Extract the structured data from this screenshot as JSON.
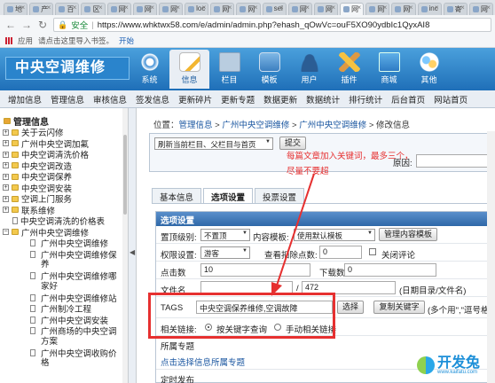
{
  "browser": {
    "tabs": [
      "地",
      "产",
      "百",
      "区",
      "网",
      "网",
      "网",
      "loc",
      "网",
      "网",
      "sei",
      "网",
      "网",
      "网",
      "网",
      "网",
      "inc",
      "寄",
      "网"
    ],
    "address": {
      "secure_label": "安全",
      "url": "https://www.whktwx58.com/e/admin/admin.php?ehash_qOwVc=ouF5XO90ydbIc1QyxAI8"
    },
    "bookmarks": {
      "apps_label": "应用",
      "hint": "请点击这里导入书签。",
      "import_label": "开始"
    }
  },
  "header": {
    "logo": "中央空调维修",
    "nav": [
      {
        "label": "系统",
        "icon": "system-gear-icon"
      },
      {
        "label": "信息",
        "icon": "info-document-icon"
      },
      {
        "label": "栏目",
        "icon": "column-folder-icon"
      },
      {
        "label": "模板",
        "icon": "template-window-icon"
      },
      {
        "label": "用户",
        "icon": "user-icon"
      },
      {
        "label": "插件",
        "icon": "plugin-tools-icon"
      },
      {
        "label": "商城",
        "icon": "shop-icon"
      },
      {
        "label": "其他",
        "icon": "other-icon"
      }
    ]
  },
  "menubar": [
    "增加信息",
    "管理信息",
    "审核信息",
    "签发信息",
    "更新碎片",
    "更新专题",
    "数据更新",
    "数据统计",
    "排行统计",
    "后台首页",
    "网站首页"
  ],
  "tree": {
    "title": "管理信息",
    "top_nodes": [
      "关于云闪修",
      "广州中央空调加氟",
      "中央空调清洗价格",
      "中央空调改造",
      "中央空调保养",
      "中央空调安装",
      "空调上门服务",
      "联系维修"
    ],
    "leaf_price": "中央空调清洗的价格表",
    "open_node": "广州中央空调维修",
    "children": [
      {
        "text": "广州中央空调维修"
      },
      {
        "text": "广州中央空调维修保",
        "cont": "养"
      },
      {
        "text": "广州中央空调维修哪",
        "cont": "家好"
      },
      {
        "text": "广州中央空调维修站"
      },
      {
        "text": "广州制冷工程"
      },
      {
        "text": "广州中央空调安装"
      },
      {
        "text": "广州商场的中央空调",
        "cont": "方案"
      },
      {
        "text": "广州中央空调收购价",
        "cont": "格"
      }
    ]
  },
  "main": {
    "breadcrumb": {
      "prefix": "位置：",
      "items": [
        "管理信息",
        "广州中央空调维修",
        "广州中央空调维修",
        "修改信息"
      ],
      "sep": " > "
    },
    "refresh_select": "刷新当前栏目、父栏目与首页",
    "submit_label": "提交",
    "origin_label": "原因:",
    "annotation_line1": "每篇文章加入关键词，最多三个，",
    "annotation_line2": "尽量不要超",
    "tabs": [
      "基本信息",
      "选项设置",
      "投票设置"
    ],
    "section_title": "选项设置",
    "form": {
      "top_label": "置顶级别:",
      "top_value": "不置顶",
      "tpl_label": "内容模板:",
      "tpl_value": "使用默认模板",
      "tpl_btn": "管理内容模板",
      "perm_label": "权限设置:",
      "perm_value": "游客",
      "points_label": "查看扣除点数:",
      "points_value": "0",
      "close_comment": "关闭评论",
      "clicks_label": "点击数",
      "clicks_value": "10",
      "downloads_label": "下载数",
      "downloads_value": "0",
      "filename_label": "文件名",
      "filename_value": "",
      "filename_value2": "472",
      "filename_hint": "(日期目录/文件名)",
      "tags_label": "TAGS",
      "tags_value": "中央空调保养维修,空调故障",
      "choose_btn": "选择",
      "copy_btn": "复制关键字",
      "tags_hint": "(多个用\",\"逗号格开)",
      "related_label": "相关链接:",
      "related_opt1": "按关键字查询",
      "related_opt2": "手动相关链接",
      "special_label": "所属专题",
      "special_link": "点击选择信息所属专题",
      "timing_label": "定时发布"
    }
  },
  "watermark": {
    "title": "开发兔",
    "sub": "www.kaifatu.com"
  },
  "colors": {
    "header_blue": "#1f6fb8",
    "annotation_red": "#e63030",
    "link_blue": "#1a56a0"
  }
}
